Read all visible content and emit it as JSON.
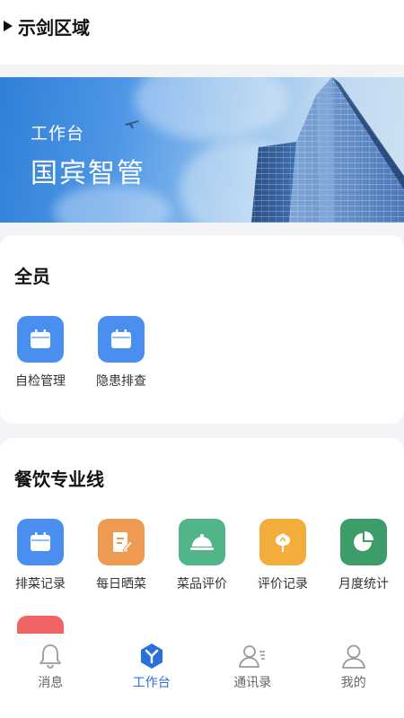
{
  "header": {
    "title": "示剑区域"
  },
  "banner": {
    "subtitle": "工作台",
    "title": "国宾智管"
  },
  "sections": [
    {
      "title": "全员",
      "items": [
        {
          "label": "自检管理",
          "icon": "calendar-icon",
          "color": "#4a8ff0"
        },
        {
          "label": "隐患排查",
          "icon": "calendar-icon",
          "color": "#4a8ff0"
        }
      ]
    },
    {
      "title": "餐饮专业线",
      "items": [
        {
          "label": "排菜记录",
          "icon": "calendar-icon",
          "color": "#4a8ff0"
        },
        {
          "label": "每日晒菜",
          "icon": "document-edit-icon",
          "color": "#ef9a52"
        },
        {
          "label": "菜品评价",
          "icon": "food-cloche-icon",
          "color": "#52b58a"
        },
        {
          "label": "评价记录",
          "icon": "flower-icon",
          "color": "#f2ad3a"
        },
        {
          "label": "月度统计",
          "icon": "pie-chart-icon",
          "color": "#3d9d68"
        },
        {
          "label": "",
          "icon": "partial-icon",
          "color": "#f06464"
        }
      ]
    }
  ],
  "nav": [
    {
      "label": "消息",
      "icon": "bell-icon",
      "active": false
    },
    {
      "label": "工作台",
      "icon": "workbench-icon",
      "active": true
    },
    {
      "label": "通讯录",
      "icon": "contacts-icon",
      "active": false
    },
    {
      "label": "我的",
      "icon": "user-icon",
      "active": false
    }
  ],
  "colors": {
    "primary": "#2a6fe0",
    "background": "#f2f4f7"
  }
}
